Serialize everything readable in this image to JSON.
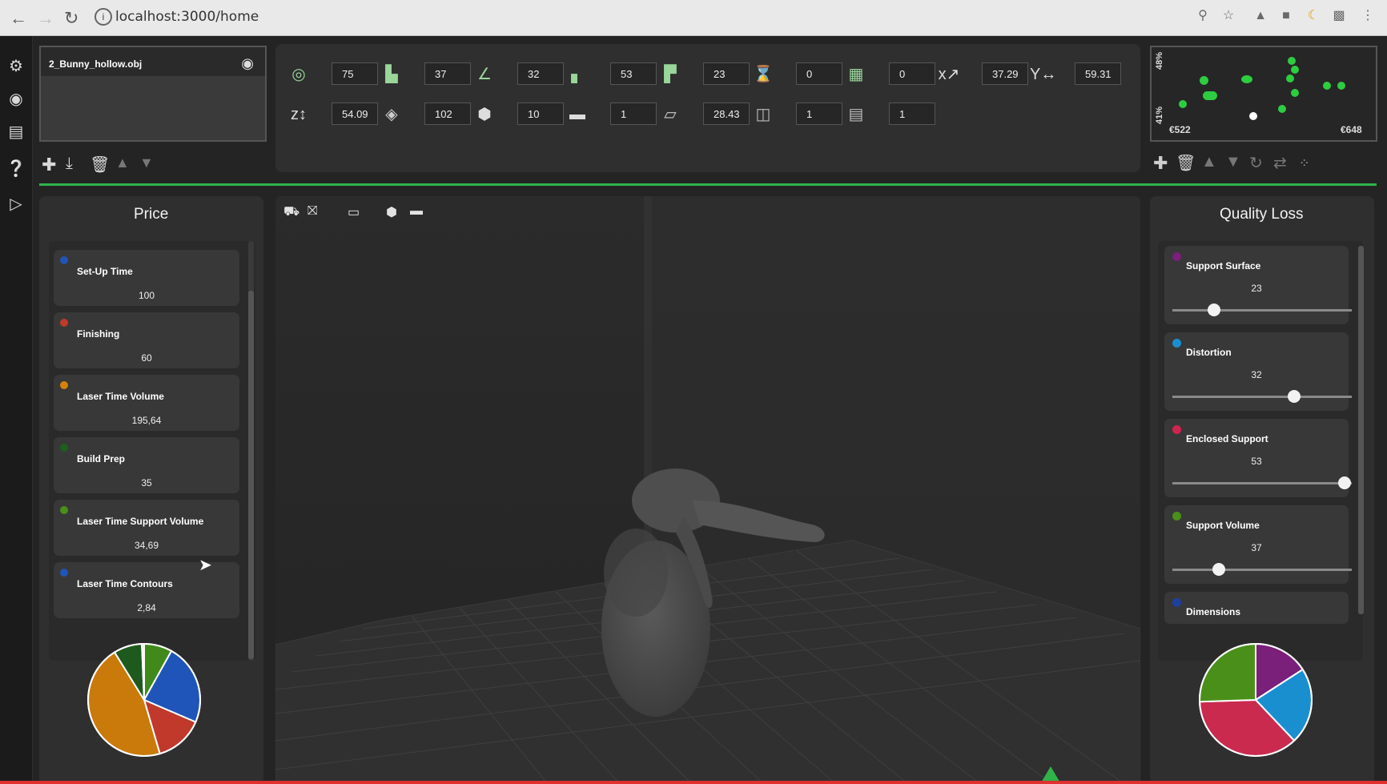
{
  "browser": {
    "url": "localhost:3000/home",
    "info_icon": "info-icon"
  },
  "sidebar_icons": [
    "settings-gear-icon",
    "eye-icon",
    "layers-icon",
    "help-icon",
    "play-icon"
  ],
  "files": {
    "name": "2_Bunny_hollow.obj"
  },
  "params": {
    "row1": [
      "75",
      "37",
      "32",
      "53",
      "23",
      "0",
      "0",
      "37.29",
      "59.31"
    ],
    "row2": [
      "54.09",
      "102",
      "10",
      "1",
      "28.43",
      "1",
      "1"
    ]
  },
  "minimap": {
    "y_top_label": "48%",
    "y_bottom_label": "41%",
    "x_left_label": "€522",
    "x_right_label": "€648",
    "accent": "#2ecc40"
  },
  "price": {
    "title": "Price",
    "items": [
      {
        "label": "Set-Up Time",
        "value": "100",
        "color": "#1f55b8"
      },
      {
        "label": "Finishing",
        "value": "60",
        "color": "#c0392b"
      },
      {
        "label": "Laser Time Volume",
        "value": "195,64",
        "color": "#d4820a"
      },
      {
        "label": "Build Prep",
        "value": "35",
        "color": "#1e5e1e"
      },
      {
        "label": "Laser Time Support Volume",
        "value": "34,69",
        "color": "#4a8f1a"
      },
      {
        "label": "Laser Time Contours",
        "value": "2,84",
        "color": "#1f55b8"
      }
    ]
  },
  "quality": {
    "title": "Quality Loss",
    "items": [
      {
        "label": "Support Surface",
        "value": "23",
        "level": 0.23,
        "color": "#7a1f7a"
      },
      {
        "label": "Distortion",
        "value": "32",
        "level": 0.68,
        "color": "#1a8fd0"
      },
      {
        "label": "Enclosed Support",
        "value": "53",
        "level": 0.96,
        "color": "#d0234f"
      },
      {
        "label": "Support Volume",
        "value": "37",
        "level": 0.26,
        "color": "#4a8f1a"
      },
      {
        "label": "Dimensions",
        "value": "",
        "level": null,
        "color": "#1f3f9f"
      }
    ]
  },
  "chart_data": [
    {
      "type": "pie",
      "title": "",
      "slices": [
        {
          "name": "Laser Time Support Volume",
          "value": 34.69,
          "color": "#3f8a1a"
        },
        {
          "name": "Set-Up Time",
          "value": 100,
          "color": "#1f55b8"
        },
        {
          "name": "Finishing",
          "value": 60,
          "color": "#c0392b"
        },
        {
          "name": "Laser Time Volume",
          "value": 195.64,
          "color": "#c97a0b"
        },
        {
          "name": "Build Prep",
          "value": 35,
          "color": "#1e5a1e"
        },
        {
          "name": "Laser Time Contours",
          "value": 2.84,
          "color": "#e8e8e8"
        }
      ]
    },
    {
      "type": "pie",
      "title": "",
      "slices": [
        {
          "name": "Support Surface",
          "value": 23,
          "color": "#7a1f7a"
        },
        {
          "name": "Distortion",
          "value": 32,
          "color": "#1a8fd0"
        },
        {
          "name": "Enclosed Support",
          "value": 53,
          "color": "#c92a4e"
        },
        {
          "name": "Support Volume",
          "value": 37,
          "color": "#4a8f1a"
        }
      ]
    }
  ]
}
